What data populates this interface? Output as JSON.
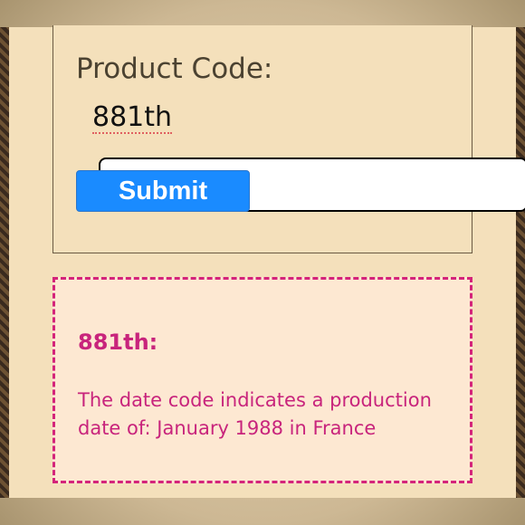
{
  "form": {
    "label": "Product Code:",
    "input_value": "881th",
    "submit_label": "Submit"
  },
  "result": {
    "title": "881th:",
    "text": "The date code indicates a production date of: January 1988 in France"
  },
  "colors": {
    "panel_bg": "#f4e0bb",
    "submit_bg": "#1a8bff",
    "result_border": "#d4247a",
    "result_text": "#c8247c",
    "result_bg": "#fde8d2"
  }
}
